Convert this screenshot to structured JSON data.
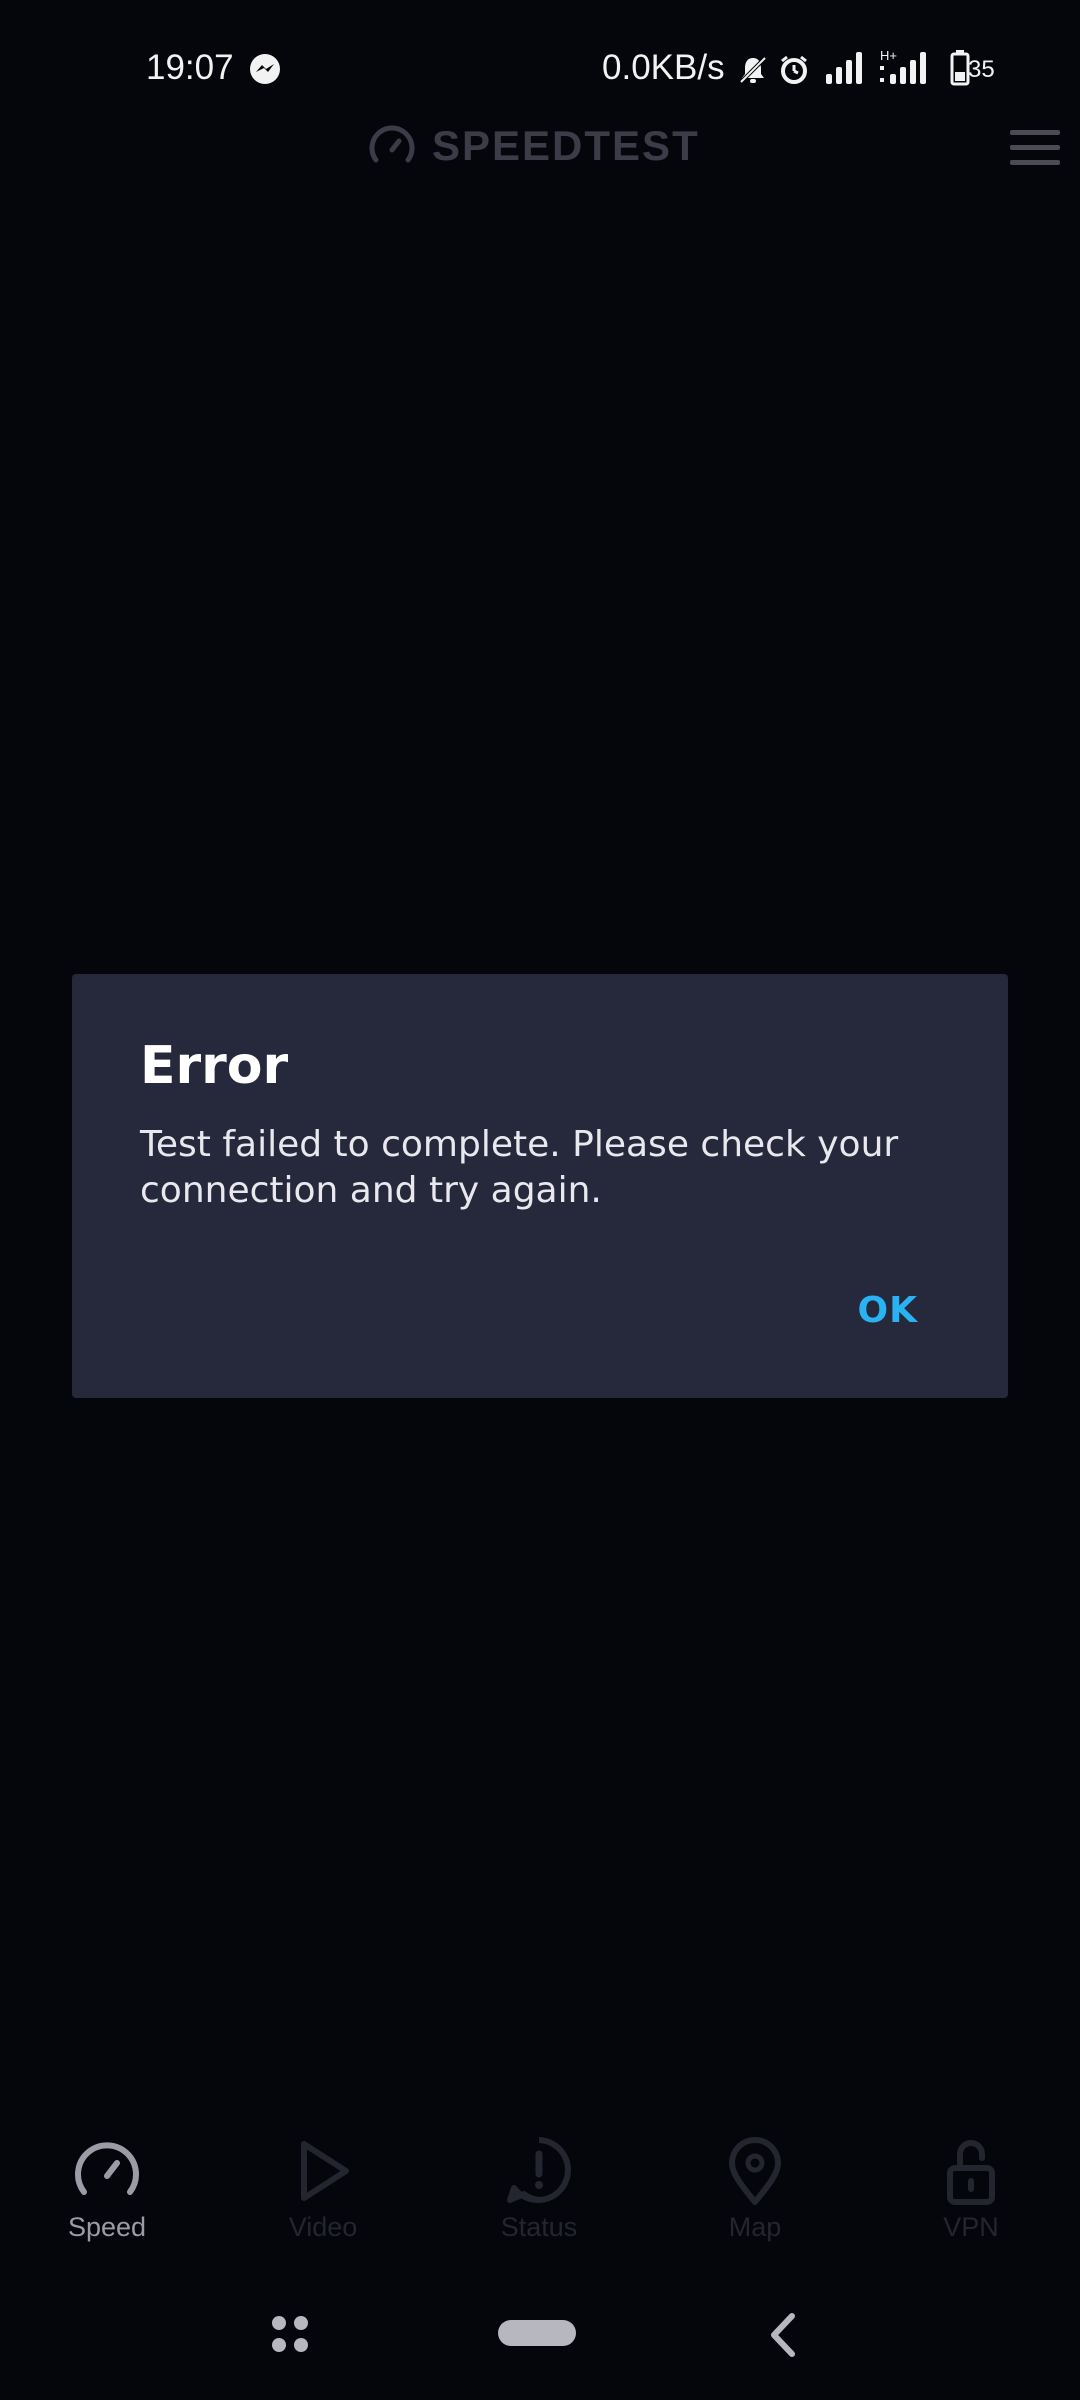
{
  "status_bar": {
    "time": "19:07",
    "network_speed": "0.0KB/s",
    "battery_level": "35",
    "icons": [
      "messenger-icon",
      "mute-icon",
      "alarm-icon",
      "signal-icon",
      "h-plus-signal-icon",
      "battery-icon"
    ]
  },
  "header": {
    "app_name": "SPEEDTEST"
  },
  "dialog": {
    "title": "Error",
    "message": "Test failed to complete. Please check your connection and try again.",
    "ok_label": "OK"
  },
  "bottom_nav": {
    "items": [
      {
        "label": "Speed",
        "icon": "speedometer-icon",
        "active": true
      },
      {
        "label": "Video",
        "icon": "play-icon",
        "active": false
      },
      {
        "label": "Status",
        "icon": "status-alert-icon",
        "active": false
      },
      {
        "label": "Map",
        "icon": "map-pin-icon",
        "active": false
      },
      {
        "label": "VPN",
        "icon": "unlock-icon",
        "active": false
      }
    ]
  },
  "colors": {
    "background": "#05060b",
    "dialog_background": "#26283b",
    "accent": "#2ab3f2",
    "header_text": "#3b3c47"
  }
}
